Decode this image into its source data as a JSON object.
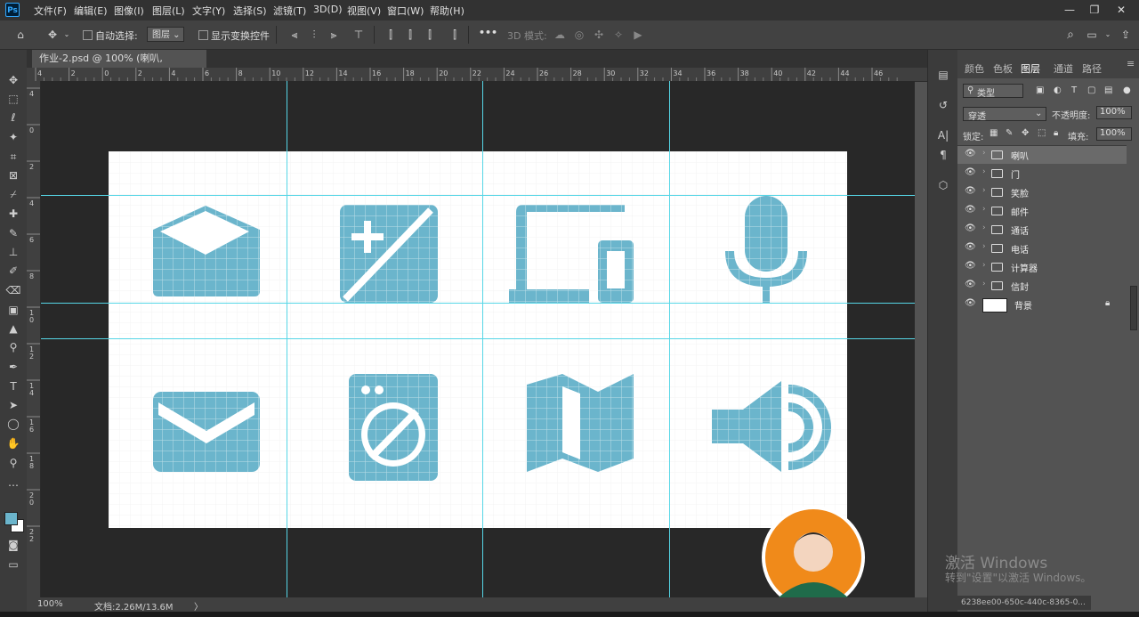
{
  "menubar": {
    "logo": "Ps",
    "items": [
      "文件(F)",
      "编辑(E)",
      "图像(I)",
      "图层(L)",
      "文字(Y)",
      "选择(S)",
      "滤镜(T)",
      "3D(D)",
      "视图(V)",
      "窗口(W)",
      "帮助(H)"
    ],
    "window_controls": [
      "—",
      "❐",
      "✕"
    ]
  },
  "options": {
    "auto_select_label": "自动选择:",
    "auto_select_value": "图层",
    "show_transform_label": "显示变换控件",
    "more": "•••",
    "mode_3d_label": "3D 模式:"
  },
  "document": {
    "tab_label": "作业-2.psd @ 100% (喇叭, RGB/8#) *",
    "close": "×",
    "canvas_bg": "#ffffff",
    "icon_color": "#6bb5cc",
    "guide_color": "#56d6e6",
    "pasteboard_color": "#282828"
  },
  "rulers": {
    "h_ticks": [
      "4",
      "2",
      "0",
      "2",
      "4",
      "6",
      "8",
      "10",
      "12",
      "14",
      "16",
      "18",
      "20",
      "22",
      "24",
      "26",
      "28",
      "30",
      "32",
      "34",
      "36",
      "38",
      "40",
      "42",
      "44",
      "46"
    ],
    "v_ticks": [
      "4",
      "0",
      "2",
      "4",
      "6",
      "8",
      "1\n0",
      "1\n2",
      "1\n4",
      "1\n6",
      "1\n8",
      "2\n0",
      "2\n2"
    ]
  },
  "status": {
    "zoom": "100%",
    "doc_size": "文档:2.26M/13.6M",
    "arrow": "〉"
  },
  "panel": {
    "tabs": [
      "颜色",
      "色板",
      "图层",
      "通道",
      "路径"
    ],
    "active_tab": "图层",
    "filter_value": "类型",
    "blend_mode": "穿透",
    "opacity_label": "不透明度:",
    "opacity_value": "100%",
    "lock_label": "锁定:",
    "fill_label": "填充:",
    "fill_value": "100%",
    "layers": [
      {
        "name": "喇叭",
        "type": "group",
        "selected": true
      },
      {
        "name": "门",
        "type": "group",
        "selected": false
      },
      {
        "name": "笑脸",
        "type": "group",
        "selected": false
      },
      {
        "name": "邮件",
        "type": "group",
        "selected": false
      },
      {
        "name": "通话",
        "type": "group",
        "selected": false
      },
      {
        "name": "电话",
        "type": "group",
        "selected": false
      },
      {
        "name": "计算器",
        "type": "group",
        "selected": false
      },
      {
        "name": "信封",
        "type": "group",
        "selected": false
      },
      {
        "name": "背景",
        "type": "background",
        "selected": false
      }
    ]
  },
  "watermark": {
    "line1": "激活 Windows",
    "line2": "转到\"设置\"以激活 Windows。"
  },
  "taskbar_hint": "6238ee00-650c-440c-8365-0..."
}
